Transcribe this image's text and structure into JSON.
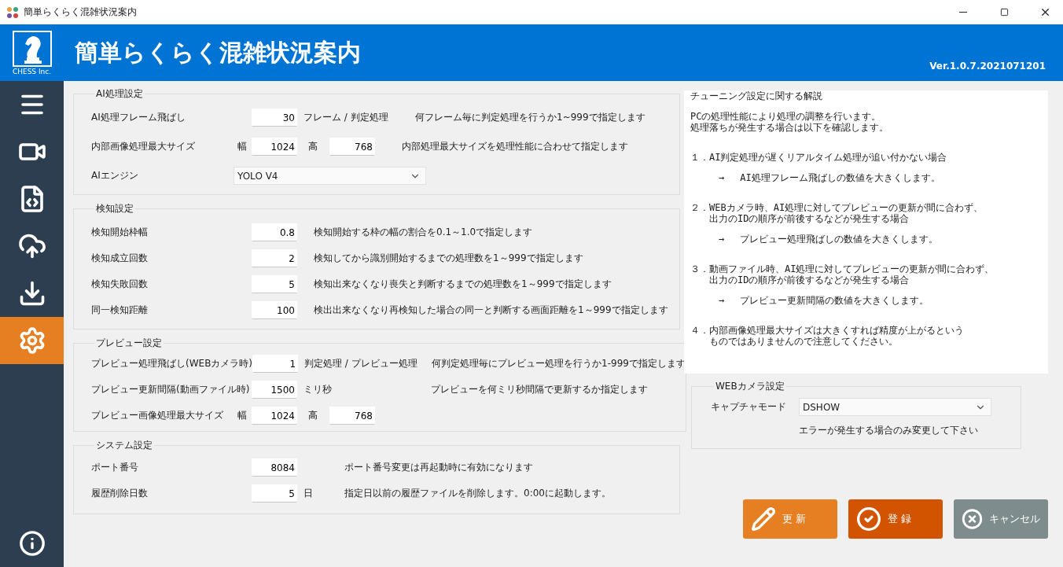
{
  "window": {
    "title": "簡単らくらく混雑状況案内"
  },
  "header": {
    "company": "CHESS Inc.",
    "title": "簡単らくらく混雑状況案内",
    "version": "Ver.1.0.7.2021071201"
  },
  "sidebar": {
    "items": [
      {
        "kind": "menu",
        "selected": false
      },
      {
        "kind": "camera",
        "selected": false
      },
      {
        "kind": "file",
        "selected": false
      },
      {
        "kind": "upload",
        "selected": false
      },
      {
        "kind": "download",
        "selected": false
      },
      {
        "kind": "settings",
        "selected": true
      }
    ],
    "bottom": {
      "kind": "info"
    }
  },
  "groups": [
    {
      "kind": "ai",
      "title": "AI処理設定",
      "rows": [
        {
          "kind": "input",
          "label": "AI処理フレーム飛ばし",
          "value": "30",
          "unit": "フレーム / 判定処理",
          "description": "何フレーム毎に判定処理を行うか1~999で指定します"
        },
        {
          "kind": "input",
          "label": "内部画像処理最大サイズ",
          "prefix": "幅",
          "value": "1024",
          "second_prefix": "高",
          "second_value": "768",
          "description": "内部処理最大サイズを処理性能に合わせて指定します"
        },
        {
          "kind": "dropdown",
          "label": "AIエンジン",
          "value": "YOLO V4"
        }
      ]
    },
    {
      "kind": "detect",
      "title": "検知設定",
      "rows": [
        {
          "kind": "input",
          "label": "検知開始枠幅",
          "value": "0.8",
          "description": "検知開始する枠の幅の割合を0.1～1.0で指定します"
        },
        {
          "kind": "input",
          "label": "検知成立回数",
          "value": "2",
          "description": "検知してから識別開始するまでの処理数を1～999で指定します"
        },
        {
          "kind": "input",
          "label": "検知失敗回数",
          "value": "5",
          "description": "検知出来なくなり喪失と判断するまでの処理数を1～999で指定します"
        },
        {
          "kind": "input",
          "label": "同一検知距離",
          "value": "100",
          "description": "検出出来なくなり再検知した場合の同一と判断する画面距離を1～999で指定します"
        }
      ]
    },
    {
      "kind": "preview",
      "title": "プレビュー設定",
      "rows": [
        {
          "kind": "input",
          "label": "プレビュー処理飛ばし(WEBカメラ時)",
          "value": "1",
          "unit": "判定処理 / プレビュー処理",
          "description": "何判定処理毎にプレビュー処理を行うか1-999で指定します"
        },
        {
          "kind": "input",
          "label": "プレビュー更新間隔(動画ファイル時)",
          "value": "1500",
          "unit": "ミリ秒",
          "description": "プレビューを何ミリ秒間隔で更新するか指定します"
        },
        {
          "kind": "input",
          "label": "プレビュー画像処理最大サイズ",
          "prefix": "幅",
          "value": "1024",
          "second_prefix": "高",
          "second_value": "768"
        }
      ]
    },
    {
      "kind": "system",
      "title": "システム設定",
      "rows": [
        {
          "kind": "input",
          "label": "ポート番号",
          "value": "8084",
          "description": "ポート番号変更は再起動時に有効になります"
        },
        {
          "kind": "input",
          "label": "履歴削除日数",
          "value": "5",
          "unit": "日",
          "description": "指定日以前の履歴ファイルを削除します。0:00に起動します。"
        }
      ]
    }
  ],
  "help": {
    "title": "チューニング設定に関する解説",
    "intro": [
      "PCの処理性能により処理の調整を行います。",
      "処理落ちが発生する場合は以下を確認します。"
    ],
    "items": [
      {
        "number": "１．",
        "lines": [
          "AI判定処理が遅くリアルタイム処理が追い付かない場合"
        ],
        "arrow": "→",
        "action": "AI処理フレーム飛ばしの数値を大きくします。"
      },
      {
        "number": "２．",
        "lines": [
          "WEBカメラ時、AI処理に対してプレビューの更新が間に合わず、",
          "出力のIDの順序が前後するなどが発生する場合"
        ],
        "arrow": "→",
        "action": "プレビュー処理飛ばしの数値を大きくします。"
      },
      {
        "number": "３．",
        "lines": [
          "動画ファイル時、AI処理に対してプレビューの更新が間に合わず、",
          "出力のIDの順序が前後するなどが発生する場合"
        ],
        "arrow": "→",
        "action": "プレビュー更新間隔の数値を大きくします。"
      },
      {
        "number": "４．",
        "lines": [
          "内部画像処理最大サイズは大きくすれば精度が上がるという",
          "ものではありませんので注意してください。"
        ]
      }
    ]
  },
  "webcam": {
    "title": "WEBカメラ設定",
    "label": "キャプチャモード",
    "value": "DSHOW",
    "note": "エラーが発生する場合のみ変更して下さい"
  },
  "buttons": [
    {
      "kind": "update",
      "label": "更 新"
    },
    {
      "kind": "register",
      "label": "登 録"
    },
    {
      "kind": "cancel",
      "label": "キャンセル"
    }
  ]
}
